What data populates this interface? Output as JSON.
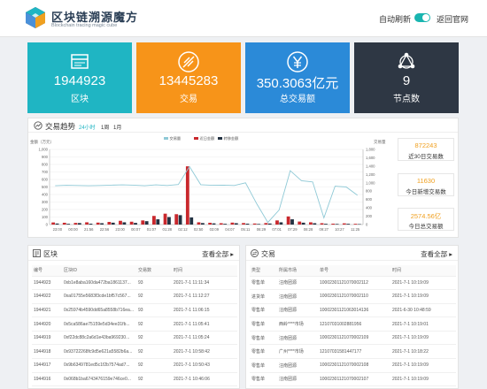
{
  "header": {
    "title": "区块链溯源魔方",
    "subtitle": "Blockchain tracing magic cube",
    "logo_icon": "cube-logo-icon",
    "auto_refresh_label": "自动刷新",
    "auto_refresh_on": true,
    "back_label": "返回官网"
  },
  "stats": [
    {
      "value": "1944923",
      "label": "区块",
      "icon": "block-icon",
      "color": "#1fb5c3"
    },
    {
      "value": "13445283",
      "label": "交易",
      "icon": "transaction-icon",
      "color": "#f79419"
    },
    {
      "value": "350.3063亿元",
      "label": "总交易额",
      "icon": "yen-icon",
      "color": "#2b8ad8"
    },
    {
      "value": "9",
      "label": "节点数",
      "icon": "node-network-icon",
      "color": "#2e3744"
    }
  ],
  "trend": {
    "title": "交易趋势",
    "ranges": [
      "24小时",
      "1周",
      "1月"
    ],
    "active_range": "24小时",
    "summary": [
      {
        "value": "872243",
        "label": "近30日交易数"
      },
      {
        "value": "11630",
        "label": "今日新增交易数"
      },
      {
        "value": "2574.56亿",
        "label": "今日总交易额"
      }
    ]
  },
  "chart_data": {
    "type": "bar",
    "ylabel": "金额（万元）",
    "y2label": "交易量",
    "legend": [
      "交易量",
      "近日金额",
      "转移金额"
    ],
    "legend_position": "top-center",
    "colors": {
      "交易量": "#8fc9d6",
      "近日金额": "#c9282d",
      "转移金额": "#233242"
    },
    "ylim": [
      0,
      1000
    ],
    "yticks": [
      0,
      100,
      200,
      300,
      400,
      500,
      600,
      700,
      800,
      900,
      "1,000"
    ],
    "y2lim": [
      0,
      1800
    ],
    "y2ticks": [
      0,
      200,
      400,
      600,
      800,
      "1,000",
      "1,200",
      "1,400",
      "1,600",
      "1,800"
    ],
    "categories": [
      "23:00",
      "00:00",
      "21:56",
      "22:56",
      "23:00",
      "00:07",
      "01:07",
      "01:28",
      "02:12",
      "02:50",
      "03:09",
      "04:07",
      "05:11",
      "06:29",
      "07:01",
      "07:29",
      "08:28",
      "09:27",
      "10:27",
      "11:25"
    ],
    "series": [
      {
        "name": "近日金额",
        "values": [
          28,
          24,
          22,
          30,
          26,
          35,
          50,
          38,
          55,
          115,
          145,
          138,
          775,
          30,
          24,
          18,
          26,
          20,
          14,
          20,
          55,
          108,
          40,
          30,
          18,
          12,
          16,
          10
        ]
      },
      {
        "name": "转移金额",
        "values": [
          14,
          10,
          20,
          12,
          18,
          25,
          30,
          22,
          45,
          70,
          100,
          125,
          95,
          20,
          16,
          10,
          18,
          12,
          8,
          14,
          30,
          70,
          25,
          18,
          10,
          8,
          10,
          6
        ]
      },
      {
        "name": "交易量",
        "values": [
          930,
          940,
          935,
          930,
          935,
          945,
          950,
          945,
          930,
          950,
          935,
          960,
          1390,
          955,
          940,
          945,
          935,
          1000,
          500,
          50,
          350,
          1290,
          1050,
          1020,
          160,
          920,
          900,
          700
        ]
      }
    ]
  },
  "blocks": {
    "title": "区块",
    "view_all": "查看全部",
    "columns": [
      "编号",
      "区块ID",
      "交易数",
      "时间"
    ],
    "rows": [
      [
        "1944923",
        "0xb1e8aba160da472ba1861137...",
        "93",
        "2021-7-1 11:11:34"
      ],
      [
        "1944922",
        "0xa01755e5683f3cde1bf57c567...",
        "92",
        "2021-7-1 11:12:27"
      ],
      [
        "1944921",
        "0x25974b4590dd65a8558b716ea...",
        "93",
        "2021-7-1 11:06:15"
      ],
      [
        "1944920",
        "0x5ca586ae75159e5d34ee31fb...",
        "92",
        "2021-7-1 11:05:41"
      ],
      [
        "1944919",
        "0xf22dc88c2a6d1e43ba969230...",
        "92",
        "2021-7-1 11:05:24"
      ],
      [
        "1944918",
        "0x93722268fc9d5e621a5582b6a...",
        "92",
        "2021-7-1 10:58:42"
      ],
      [
        "1944917",
        "0x9b6349781ed5c1f2b7574ad7...",
        "92",
        "2021-7-1 10:50:43"
      ],
      [
        "1944916",
        "0x068b1ba6743476159e746ce0...",
        "92",
        "2021-7-1 10:46:06"
      ]
    ]
  },
  "transactions": {
    "title": "交易",
    "view_all": "查看全部",
    "columns": [
      "类型",
      "所属市场",
      "单号",
      "时间"
    ],
    "rows": [
      [
        "零售单",
        "汪南团源",
        "10002301121070002112",
        "2021-7-1 10:19:09"
      ],
      [
        "进货单",
        "汪南团源",
        "10002301121070002110",
        "2021-7-1 10:19:09"
      ],
      [
        "零售单",
        "汪南团源",
        "10002301121063014136",
        "2021-6-30 10:48:59"
      ],
      [
        "零售单",
        "西岭****市场",
        "12107031002881956",
        "2021-7-1 10:19:01"
      ],
      [
        "零售单",
        "汪南团源",
        "10002301121070002109",
        "2021-7-1 10:19:09"
      ],
      [
        "零售单",
        "广州****市场",
        "12107031581447177",
        "2021-7-1 10:18:22"
      ],
      [
        "零售单",
        "汪南团源",
        "10002301121070002108",
        "2021-7-1 10:19:09"
      ],
      [
        "零售单",
        "汪南团源",
        "10002301121070002107",
        "2021-7-1 10:19:09"
      ]
    ]
  }
}
